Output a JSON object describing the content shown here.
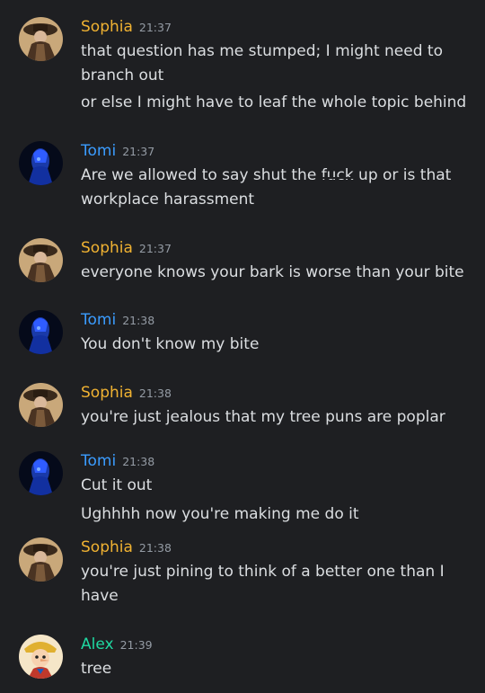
{
  "users": {
    "sophia": {
      "name": "Sophia",
      "color": "#f0b232"
    },
    "tomi": {
      "name": "Tomi",
      "color": "#3b9cff"
    },
    "alex": {
      "name": "Alex",
      "color": "#1fd8a1"
    }
  },
  "messages": [
    {
      "author": "Sophia",
      "time": "21:37",
      "lines": [
        "that question has me stumped; I might need to branch out",
        "or else I might have to leaf the whole topic behind"
      ]
    },
    {
      "author": "Tomi",
      "time": "21:37",
      "lines": [
        "Are we allowed to say shut the fuck up or is that workplace harassment"
      ]
    },
    {
      "author": "Sophia",
      "time": "21:37",
      "lines": [
        "everyone knows your bark is worse than your bite"
      ]
    },
    {
      "author": "Tomi",
      "time": "21:38",
      "lines": [
        "You don't know my bite"
      ]
    },
    {
      "author": "Sophia",
      "time": "21:38",
      "lines": [
        "you're just jealous that my tree puns are poplar"
      ]
    },
    {
      "author": "Tomi",
      "time": "21:38",
      "lines": [
        "Cut it out",
        "Ughhhh now you're making me do it"
      ]
    },
    {
      "author": "Sophia",
      "time": "21:38",
      "lines": [
        "you're just pining to think of a better one than I have"
      ]
    },
    {
      "author": "Alex",
      "time": "21:39",
      "lines": [
        "tree"
      ]
    }
  ],
  "msg2": {
    "pre": "Are we allowed to say shut the ",
    "censored": "fuck",
    "post": " up or is that workplace harassment"
  }
}
